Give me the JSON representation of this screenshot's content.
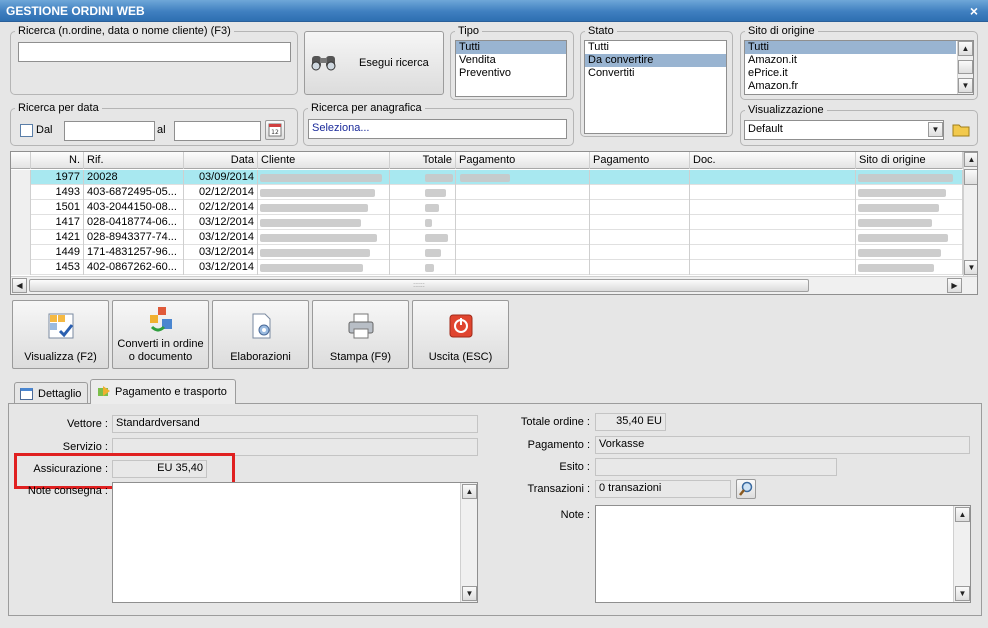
{
  "window": {
    "title": "GESTIONE ORDINI WEB",
    "close_glyph": "×"
  },
  "search": {
    "legend": "Ricerca (n.ordine, data o nome cliente) (F3)",
    "value": "",
    "button_label": "Esegui ricerca"
  },
  "tipo": {
    "legend": "Tipo",
    "options": [
      "Tutti",
      "Vendita",
      "Preventivo"
    ],
    "selected": "Tutti"
  },
  "stato": {
    "legend": "Stato",
    "options": [
      "Tutti",
      "Da convertire",
      "Convertiti"
    ],
    "selected": "Da convertire"
  },
  "sito": {
    "legend": "Sito di origine",
    "options": [
      "Tutti",
      "Amazon.it",
      "ePrice.it",
      "Amazon.fr"
    ],
    "selected": "Tutti"
  },
  "date_search": {
    "legend": "Ricerca per data",
    "dal_label": "Dal",
    "al_label": "al",
    "dal_value": "",
    "al_value": "",
    "calendar_icon": "calendar-icon"
  },
  "anagrafica": {
    "legend": "Ricerca per anagrafica",
    "value": "Seleziona..."
  },
  "visualizzazione": {
    "legend": "Visualizzazione",
    "value": "Default"
  },
  "grid": {
    "headers": [
      "N.",
      "Rif.",
      "Data",
      "Cliente",
      "Totale",
      "Pagamento",
      "Pagamento",
      "Doc.",
      "Sito di origine"
    ],
    "rows": [
      {
        "n": "1977",
        "rif": "20028",
        "data": "03/09/2014"
      },
      {
        "n": "1493",
        "rif": "403-6872495-05...",
        "data": "02/12/2014"
      },
      {
        "n": "1501",
        "rif": "403-2044150-08...",
        "data": "02/12/2014"
      },
      {
        "n": "1417",
        "rif": "028-0418774-06...",
        "data": "03/12/2014"
      },
      {
        "n": "1421",
        "rif": "028-8943377-74...",
        "data": "03/12/2014"
      },
      {
        "n": "1449",
        "rif": "171-4831257-96...",
        "data": "03/12/2014"
      },
      {
        "n": "1453",
        "rif": "402-0867262-60...",
        "data": "03/12/2014"
      }
    ],
    "scroll_grip": "::::::"
  },
  "toolbar": {
    "visualizza": "Visualizza (F2)",
    "converti_1": "Converti in ordine",
    "converti_2": "o documento",
    "elaborazioni": "Elaborazioni",
    "stampa": "Stampa (F9)",
    "uscita": "Uscita (ESC)"
  },
  "tabs": {
    "dettaglio": "Dettaglio",
    "pagamento": "Pagamento e trasporto"
  },
  "detail": {
    "vettore_label": "Vettore :",
    "vettore_value": "Standardversand",
    "servizio_label": "Servizio :",
    "servizio_value": "",
    "assicurazione_label": "Assicurazione :",
    "assicurazione_value": "EU 35,40",
    "note_consegna_label": "Note consegna :",
    "totale_label": "Totale ordine :",
    "totale_value": "35,40 EU",
    "pagamento_label": "Pagamento :",
    "pagamento_value": "Vorkasse",
    "esito_label": "Esito :",
    "esito_value": "",
    "transazioni_label": "Transazioni :",
    "transazioni_value": "0 transazioni",
    "note_label": "Note :"
  },
  "colors": {
    "title_bar": "#3f7fc0",
    "selected_row": "#a8e8f0",
    "highlight_box": "#e02020",
    "list_selection": "#99b4d1"
  }
}
